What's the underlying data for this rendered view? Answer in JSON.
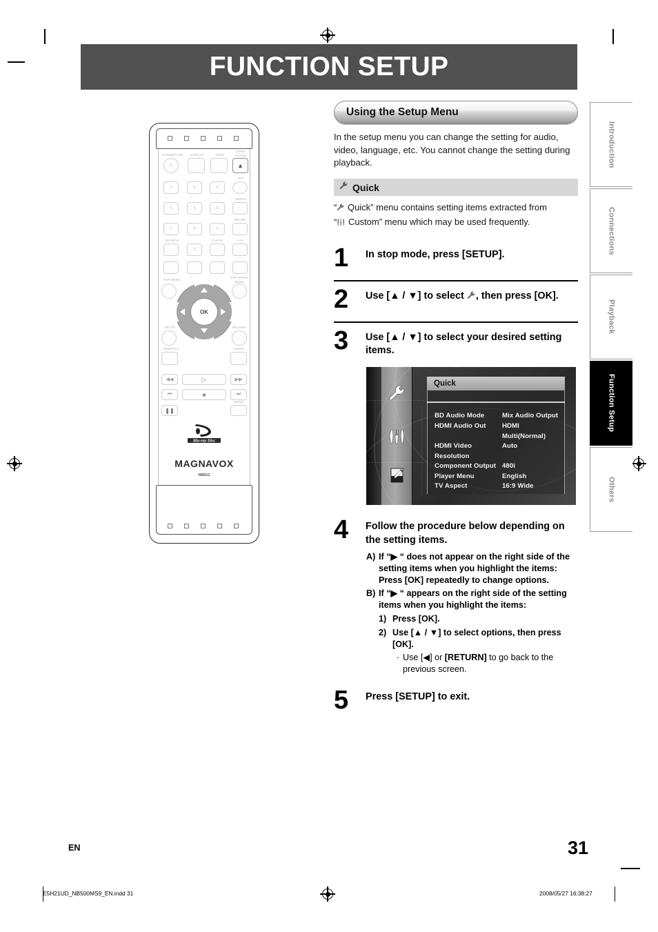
{
  "header": {
    "title": "FUNCTION SETUP"
  },
  "section": {
    "heading": "Using the Setup Menu",
    "intro": "In the setup menu you can change the setting for audio, video, language, etc. You cannot change the setting during playback.",
    "sub_heading": "Quick",
    "sub_icon": "wrench-icon",
    "note_line1_pre": "“",
    "note_line1_post": " Quick” menu contains setting items extracted from",
    "note_line2_pre": "“",
    "note_line2_post": " Custom” menu which may be used frequently."
  },
  "steps": [
    {
      "num": "1",
      "text": "In stop mode, press [SETUP]."
    },
    {
      "num": "2",
      "text_a": "Use [▲ / ▼] to select ",
      "text_b": ", then press [OK]."
    },
    {
      "num": "3",
      "text": "Use [▲ / ▼] to select your desired setting items."
    },
    {
      "num": "4",
      "text": "Follow the procedure below depending on the setting items."
    },
    {
      "num": "5",
      "text": "Press [SETUP] to exit."
    }
  ],
  "osd": {
    "tab_label": "Quick",
    "icons": [
      "wrench-icon",
      "tools-icon",
      "document-pencil-icon"
    ],
    "rows": [
      {
        "key": "BD Audio Mode",
        "value": "Mix Audio Output"
      },
      {
        "key": "HDMI Audio Out",
        "value": "HDMI Multi(Normal)"
      },
      {
        "key": "HDMI Video Resolution",
        "value": "Auto"
      },
      {
        "key": "Component Output",
        "value": "480i"
      },
      {
        "key": "Player Menu",
        "value": "English"
      },
      {
        "key": "TV Aspect",
        "value": "16:9 Wide"
      }
    ]
  },
  "procedure": {
    "a_marker": "A)",
    "a_line1_pre": "If “",
    "a_line1_post": " “ does not appear on the right side of the setting items when you highlight the items:",
    "a_line2": "Press [OK] repeatedly to change options.",
    "b_marker": "B)",
    "b_line1_pre": "If “",
    "b_line1_post": " “ appears on the right side of the setting items when you highlight the items:",
    "b_item1_marker": "1)",
    "b_item1": "Press [OK].",
    "b_item2_marker": "2)",
    "b_item2": "Use [▲ / ▼] to select options, then press [OK].",
    "b_bullet_marker": "·",
    "b_bullet_pre": "Use [◀] or ",
    "b_bullet_bold": "[RETURN]",
    "b_bullet_post": " to go back to the previous screen."
  },
  "side_tabs": [
    {
      "label": "Introduction",
      "active": false
    },
    {
      "label": "Connections",
      "active": false
    },
    {
      "label": "Playback",
      "active": false
    },
    {
      "label": "Function Setup",
      "active": true
    },
    {
      "label": "Others",
      "active": false
    }
  ],
  "remote": {
    "brand": "MAGNAVOX",
    "model": "NB812",
    "disc_logo": "Blu-ray Disc",
    "labels": {
      "standby": "STANDBY-ON",
      "display": "DISPLAY",
      "hdmi": "HDMI",
      "open_close_1": "OPEN",
      "open_close_2": "CLOSE",
      "pip": "PIP",
      "angle": "ANGLE",
      "secret": "SECRET",
      "search": "SEARCH",
      "clear": "CLEAR",
      "ab": "A-B",
      "top_menu": "TOP MENU",
      "pop_menu_1": "POP MENU",
      "pop_menu_2": "MENU",
      "setup": "SETUP",
      "return": "RETURN",
      "subtitle": "SUBTITLE",
      "audio": "AUDIO",
      "mode": "MODE",
      "ok": "OK"
    },
    "keypad": [
      "1",
      "2",
      "3",
      "4",
      "5",
      "6",
      "7",
      "8",
      "9",
      "0"
    ]
  },
  "footer": {
    "language_mark": "EN",
    "page_number": "31",
    "file_name": "E5H21UD_NB500MS9_EN.indd   31",
    "timestamp": "2008/05/27   16:38:27"
  }
}
